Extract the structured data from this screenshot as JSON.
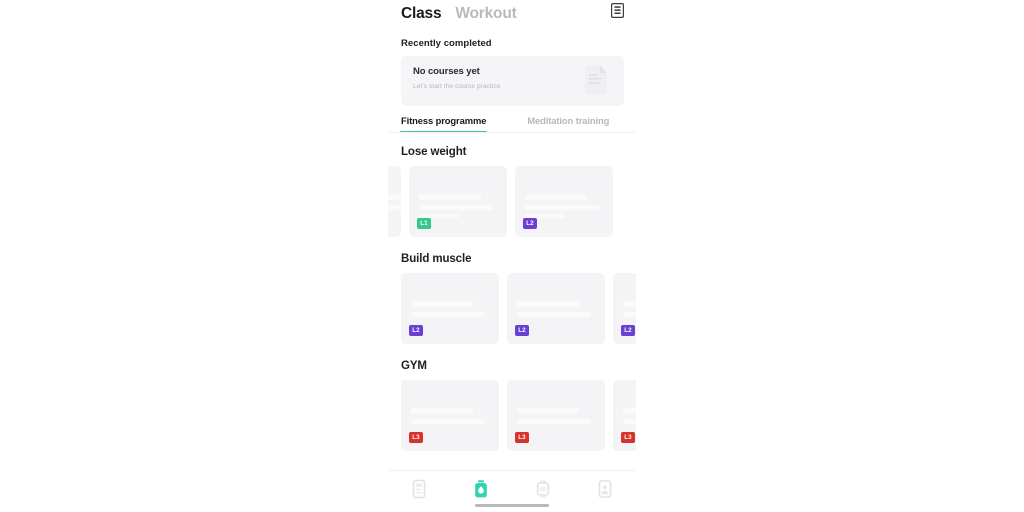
{
  "header": {
    "tabs": [
      {
        "label": "Class",
        "active": true
      },
      {
        "label": "Workout",
        "active": false
      }
    ],
    "action_icon": "document-list-icon"
  },
  "recently_completed": {
    "title": "Recently completed",
    "empty_title": "No courses yet",
    "empty_subtitle": "Let's start the course practice",
    "empty_icon": "empty-document-icon"
  },
  "subtabs": [
    {
      "label": "Fitness programme",
      "active": true
    },
    {
      "label": "Meditation training",
      "active": false
    }
  ],
  "colors": {
    "accent": "#3ccb91",
    "level1": "#35c88c",
    "level2": "#6a3fd4",
    "level3": "#d6332b",
    "card_bg": "#f4f4f6",
    "text_primary": "#1b1b1b",
    "text_muted": "#b7b7bd"
  },
  "sections": [
    {
      "title": "Lose weight",
      "scrolled": true,
      "cards": [
        {
          "sliver": true,
          "badge": null
        },
        {
          "sliver": false,
          "badge": "L1",
          "badge_color": "#35c88c"
        },
        {
          "sliver": false,
          "badge": "L2",
          "badge_color": "#6a3fd4"
        }
      ]
    },
    {
      "title": "Build muscle",
      "scrolled": false,
      "cards": [
        {
          "sliver": false,
          "badge": "L2",
          "badge_color": "#6a3fd4"
        },
        {
          "sliver": false,
          "badge": "L2",
          "badge_color": "#6a3fd4"
        },
        {
          "sliver": false,
          "badge": "L2",
          "badge_color": "#6a3fd4"
        }
      ]
    },
    {
      "title": "GYM",
      "scrolled": false,
      "cards": [
        {
          "sliver": false,
          "badge": "L3",
          "badge_color": "#d6332b"
        },
        {
          "sliver": false,
          "badge": "L3",
          "badge_color": "#d6332b"
        },
        {
          "sliver": false,
          "badge": "L3",
          "badge_color": "#d6332b"
        }
      ]
    }
  ],
  "bottom_nav": [
    {
      "icon": "news-list-icon",
      "active": false
    },
    {
      "icon": "flame-training-icon",
      "active": true
    },
    {
      "icon": "watch-device-icon",
      "active": false
    },
    {
      "icon": "profile-person-icon",
      "active": false
    }
  ]
}
